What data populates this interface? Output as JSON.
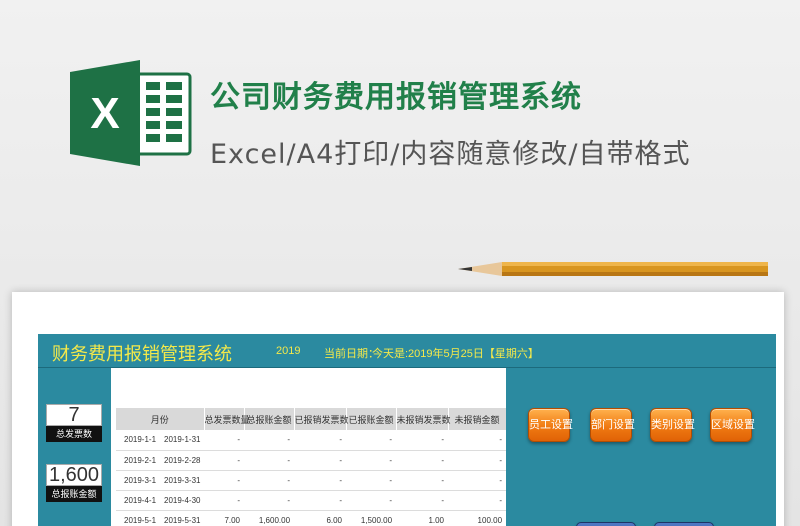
{
  "promo": {
    "title": "公司财务费用报销管理系统",
    "subtitle": "Excel/A4打印/内容随意修改/自带格式",
    "logo_letter": "X",
    "logo_icon": "excel-icon",
    "pencil_icon": "pencil-icon"
  },
  "sheet": {
    "banner": {
      "title": "财务费用报销管理系统",
      "year": "2019",
      "date_label": "当前日期：",
      "today": "今天是:2019年5月25日【星期六】"
    },
    "stats": [
      {
        "value": "7",
        "label": "总发票数"
      },
      {
        "value": "1,600",
        "label": "总报账金额"
      }
    ],
    "table": {
      "headers": [
        "",
        "月份",
        "",
        "总发票数量",
        "总报账金额",
        "已报销发票数",
        "已报账金额",
        "未报销发票数",
        "未报销金额"
      ],
      "rows": [
        [
          "2019-1-1",
          "2019-1-31",
          "-",
          "-",
          "-",
          "-",
          "-",
          "-"
        ],
        [
          "2019-2-1",
          "2019-2-28",
          "-",
          "-",
          "-",
          "-",
          "-",
          "-"
        ],
        [
          "2019-3-1",
          "2019-3-31",
          "-",
          "-",
          "-",
          "-",
          "-",
          "-"
        ],
        [
          "2019-4-1",
          "2019-4-30",
          "-",
          "-",
          "-",
          "-",
          "-",
          "-"
        ],
        [
          "2019-5-1",
          "2019-5-31",
          "7.00",
          "1,600.00",
          "6.00",
          "1,500.00",
          "1.00",
          "100.00"
        ]
      ]
    },
    "buttons": [
      "员工设置",
      "部门设置",
      "类别设置",
      "区域设置"
    ]
  },
  "colors": {
    "brand_green": "#21804a",
    "panel_teal": "#2b8aa0",
    "banner_text": "#f4e94a",
    "button_orange": "#f07a12",
    "button_blue": "#2c4f96"
  }
}
